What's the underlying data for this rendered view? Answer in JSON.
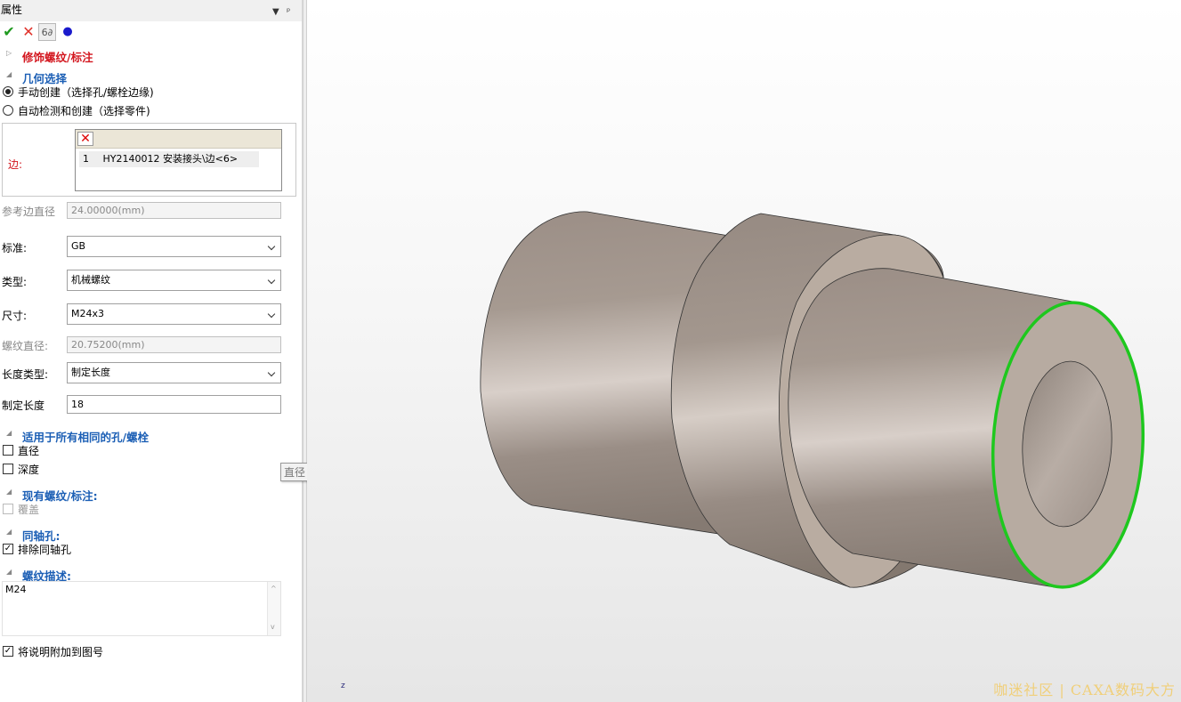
{
  "panel": {
    "title": "属性",
    "pin_icon": "pin-icon",
    "toolbar": {
      "ok_icon": "checkmark-icon",
      "cancel_icon": "close-icon",
      "preview_icon": "glasses-icon",
      "dot_icon": "dot-icon"
    },
    "sections": {
      "cosmetic": "修饰螺纹/标注",
      "geometry": "几何选择",
      "apply_all": "适用于所有相同的孔/螺栓",
      "existing": "现有螺纹/标注:",
      "coaxial": "同轴孔:",
      "thread_desc": "螺纹描述:"
    },
    "geometry": {
      "manual": "手动创建（选择孔/螺栓边缘)",
      "auto": "自动检测和创建（选择零件)",
      "manual_selected": true,
      "edge_label": "边:",
      "edge_index": "1",
      "edge_value": "HY2140012 安装接头\\边<6>"
    },
    "fields": {
      "ref_diameter_label": "参考边直径",
      "ref_diameter_value": "24.00000(mm)",
      "standard_label": "标准:",
      "standard_value": "GB",
      "type_label": "类型:",
      "type_value": "机械螺纹",
      "size_label": "尺寸:",
      "size_value": "M24x3",
      "thread_diameter_label": "螺纹直径:",
      "thread_diameter_value": "20.75200(mm)",
      "length_type_label": "长度类型:",
      "length_type_value": "制定长度",
      "length_label": "制定长度",
      "length_value": "18"
    },
    "apply_all": {
      "diameter": "直径",
      "depth": "深度",
      "diameter_checked": false,
      "depth_checked": false
    },
    "existing": {
      "cover": "覆盖",
      "cover_checked": false
    },
    "coaxial": {
      "exclude": "排除同轴孔",
      "exclude_checked": true
    },
    "description": {
      "value": "M24"
    },
    "attach": {
      "label": "将说明附加到图号",
      "checked": true
    },
    "tooltip": "直径"
  },
  "viewport": {
    "axis_label": "z",
    "watermark": "咖迷社区 | CAXA数码大方",
    "highlight_color": "#1ec81e"
  }
}
